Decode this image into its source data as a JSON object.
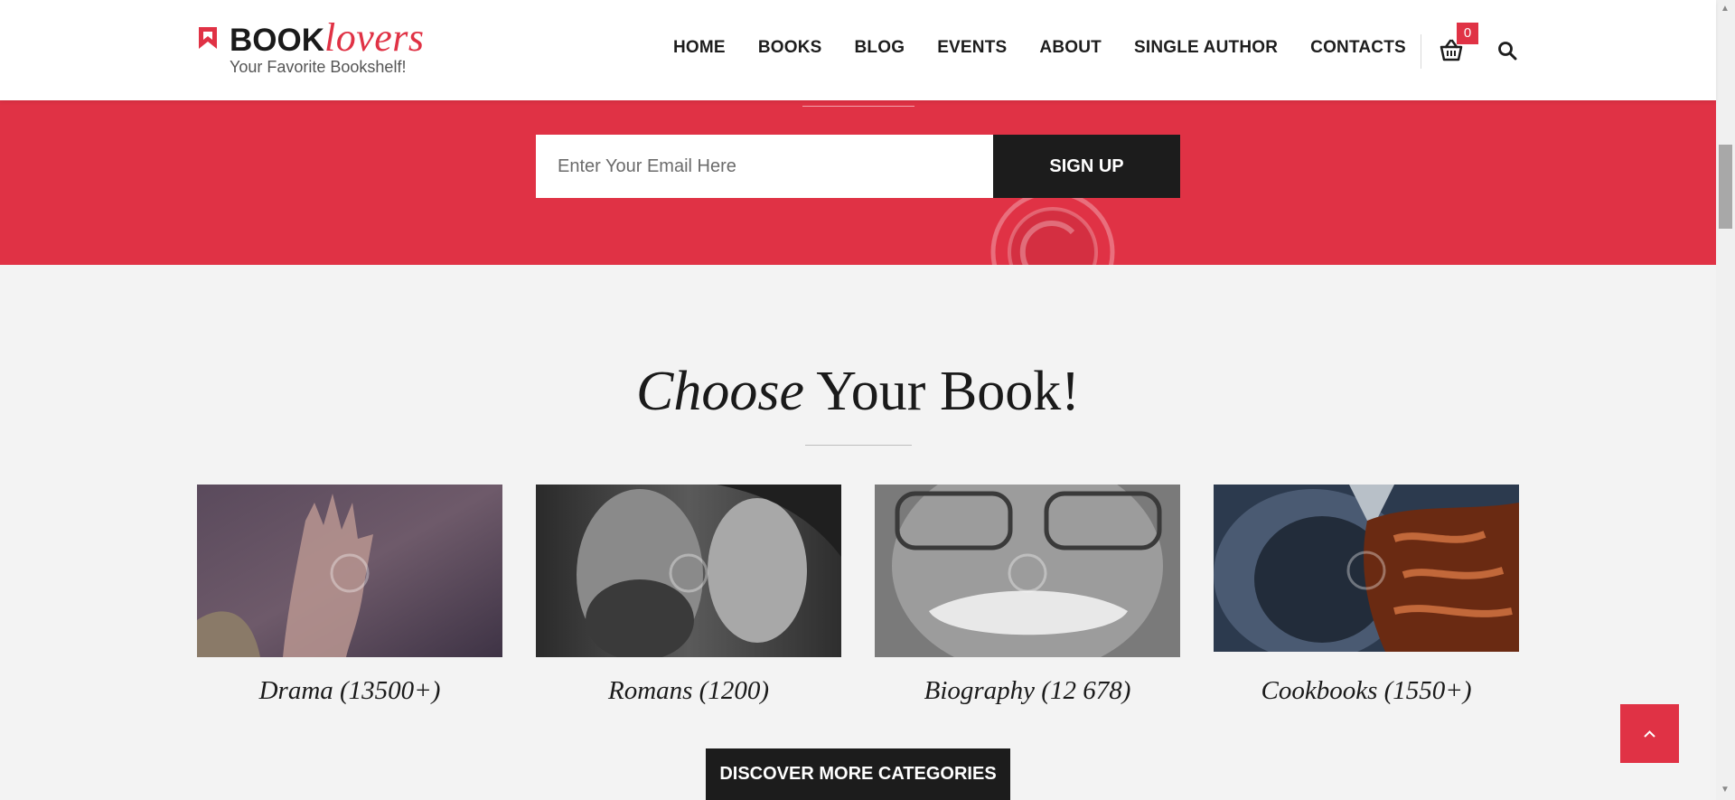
{
  "header": {
    "logo": {
      "brand_main": "BOOK",
      "brand_accent": "lovers",
      "tagline": "Your Favorite Bookshelf!"
    },
    "nav": [
      "HOME",
      "BOOKS",
      "BLOG",
      "EVENTS",
      "ABOUT",
      "SINGLE AUTHOR",
      "CONTACTS"
    ],
    "cart_count": "0",
    "icons": {
      "cart": "basket-icon",
      "search": "search-icon"
    }
  },
  "newsletter": {
    "email_placeholder": "Enter Your Email Here",
    "email_value": "",
    "signup_label": "SIGN UP"
  },
  "section": {
    "title_italic": "Choose",
    "title_rest": " Your Book!"
  },
  "categories": [
    {
      "label": "Drama (13500+)"
    },
    {
      "label": "Romans (1200)"
    },
    {
      "label": "Biography (12 678)"
    },
    {
      "label": "Cookbooks (1550+)"
    }
  ],
  "discover_label": "DISCOVER MORE CATEGORIES",
  "colors": {
    "accent": "#e03245",
    "dark": "#1c1c1c",
    "background": "#f3f3f3"
  }
}
